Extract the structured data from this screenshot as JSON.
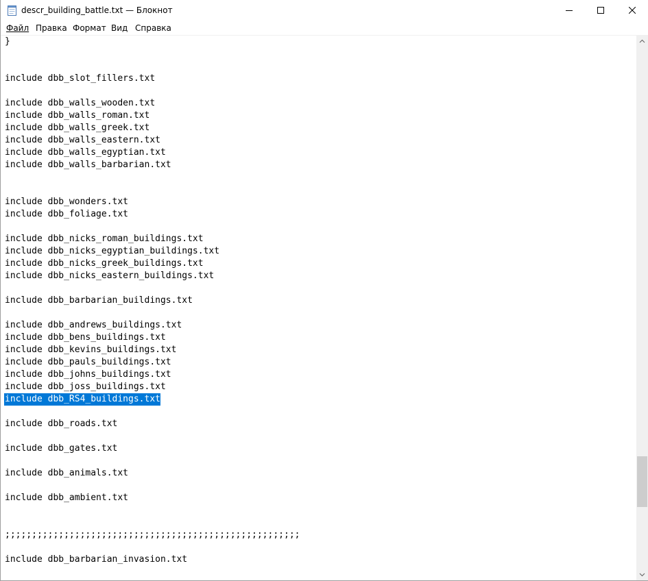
{
  "window": {
    "title": "descr_building_battle.txt — Блокнот",
    "controls": {
      "minimize": "minimize",
      "maximize": "maximize",
      "close": "close"
    }
  },
  "menu": [
    {
      "label": "Файл"
    },
    {
      "label": "Правка"
    },
    {
      "label": "Формат"
    },
    {
      "label": "Вид"
    },
    {
      "label": "Справка"
    }
  ],
  "editor": {
    "lines": [
      "}",
      "",
      "",
      "include dbb_slot_fillers.txt",
      "",
      "include dbb_walls_wooden.txt",
      "include dbb_walls_roman.txt",
      "include dbb_walls_greek.txt",
      "include dbb_walls_eastern.txt",
      "include dbb_walls_egyptian.txt",
      "include dbb_walls_barbarian.txt",
      "",
      "",
      "include dbb_wonders.txt",
      "include dbb_foliage.txt",
      "",
      "include dbb_nicks_roman_buildings.txt",
      "include dbb_nicks_egyptian_buildings.txt",
      "include dbb_nicks_greek_buildings.txt",
      "include dbb_nicks_eastern_buildings.txt",
      "",
      "include dbb_barbarian_buildings.txt",
      "",
      "include dbb_andrews_buildings.txt",
      "include dbb_bens_buildings.txt",
      "include dbb_kevins_buildings.txt",
      "include dbb_pauls_buildings.txt",
      "include dbb_johns_buildings.txt",
      "include dbb_joss_buildings.txt",
      "include dbb_RS4_buildings.txt",
      "",
      "include dbb_roads.txt",
      "",
      "include dbb_gates.txt",
      "",
      "include dbb_animals.txt",
      "",
      "include dbb_ambient.txt",
      "",
      "",
      ";;;;;;;;;;;;;;;;;;;;;;;;;;;;;;;;;;;;;;;;;;;;;;;;;;;;;;;",
      "",
      "include dbb_barbarian_invasion.txt"
    ],
    "selected_line": 29
  }
}
